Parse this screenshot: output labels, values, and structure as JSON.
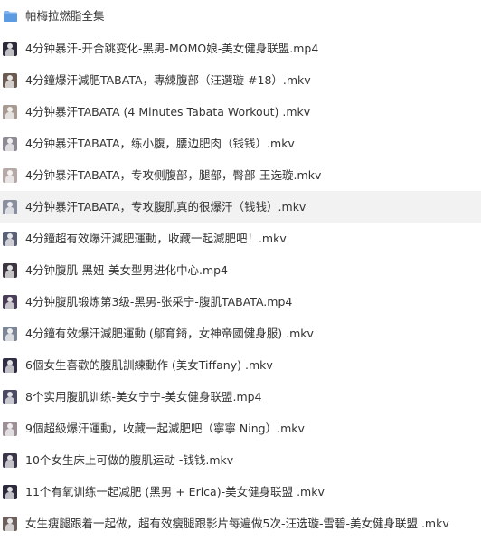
{
  "files": [
    {
      "name": "帕梅拉燃脂全集",
      "type": "folder",
      "icon": "folder-icon",
      "color": "#6fa6e6"
    },
    {
      "name": "4分钟暴汗-开合跳变化-黑男-MOMO娘-美女健身联盟.mp4",
      "type": "video",
      "icon": "video-thumbnail-icon",
      "color": "#2d2b3a"
    },
    {
      "name": "4分鐘爆汗減肥TABATA，專練腹部（汪選璇 #18）.mkv",
      "type": "video",
      "icon": "video-thumbnail-icon",
      "color": "#6b5a52"
    },
    {
      "name": "4分钟暴汗TABATA (4 Minutes Tabata Workout) .mkv",
      "type": "video",
      "icon": "video-thumbnail-icon",
      "color": "#a79b92"
    },
    {
      "name": "4分钟暴汗TABATA，练小腹，腰边肥肉（钱钱）.mkv",
      "type": "video",
      "icon": "video-thumbnail-icon",
      "color": "#8d8a93"
    },
    {
      "name": "4分钟暴汗TABATA，专攻侧腹部，腿部，臀部-王选璇.mkv",
      "type": "video",
      "icon": "video-thumbnail-icon",
      "color": "#b4a9a6"
    },
    {
      "name": "4分钟暴汗TABATA，专攻腹肌真的很爆汗（钱钱）.mkv",
      "type": "video",
      "icon": "video-thumbnail-icon",
      "color": "#8a8fa0"
    },
    {
      "name": "4分鐘超有效爆汗減肥運動，收藏一起減肥吧！.mkv",
      "type": "video",
      "icon": "video-thumbnail-icon",
      "color": "#5a6075"
    },
    {
      "name": "4分钟腹肌-黑妞-美女型男进化中心.mp4",
      "type": "video",
      "icon": "video-thumbnail-icon",
      "color": "#3d3640"
    },
    {
      "name": "4分钟腹肌锻炼第3级-黑男-张采宁-腹肌TABATA.mp4",
      "type": "video",
      "icon": "video-thumbnail-icon",
      "color": "#4a3d57"
    },
    {
      "name": "4分鐘有效爆汗減肥運動 (鄔育錡，女神帝國健身服) .mkv",
      "type": "video",
      "icon": "video-thumbnail-icon",
      "color": "#7c8596"
    },
    {
      "name": "6個女生喜歡的腹肌訓練動作 (美女Tiffany) .mkv",
      "type": "video",
      "icon": "video-thumbnail-icon",
      "color": "#2f2e45"
    },
    {
      "name": "8个实用腹肌训练-美女宁宁-美女健身联盟.mp4",
      "type": "video",
      "icon": "video-thumbnail-icon",
      "color": "#4b4a66"
    },
    {
      "name": "9個超級爆汗運動，收藏一起減肥吧（寧寧 Ning）.mkv",
      "type": "video",
      "icon": "video-thumbnail-icon",
      "color": "#9c8f96"
    },
    {
      "name": "10个女生床上可做的腹肌运动 -钱钱.mkv",
      "type": "video",
      "icon": "video-thumbnail-icon",
      "color": "#3a3548"
    },
    {
      "name": "11个有氧训练一起减肥 (黑男 + Erica)-美女健身联盟 .mkv",
      "type": "video",
      "icon": "video-thumbnail-icon",
      "color": "#2e2a3d"
    },
    {
      "name": "女生瘦腿跟着一起做，超有效瘦腿跟影片每遍做5次-汪选璇-雪碧-美女健身联盟 .mkv",
      "type": "video",
      "icon": "video-thumbnail-icon",
      "color": "#6d5f5c"
    }
  ],
  "selected_index": 6
}
